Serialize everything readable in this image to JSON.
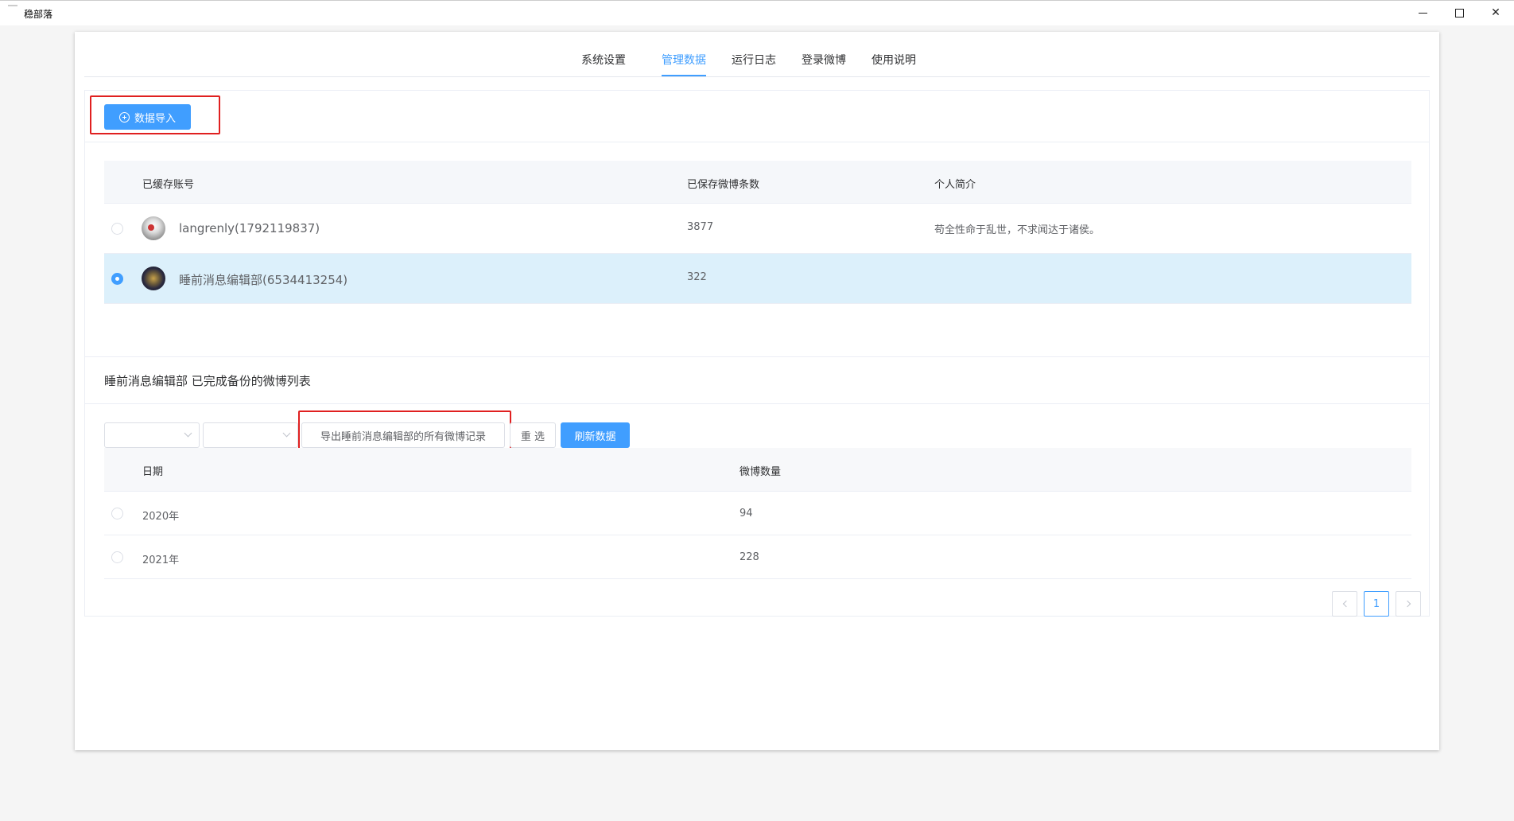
{
  "window": {
    "title": "稳部落"
  },
  "tabs": [
    {
      "label": "系统设置",
      "active": false
    },
    {
      "label": "管理数据",
      "active": true
    },
    {
      "label": "运行日志",
      "active": false
    },
    {
      "label": "登录微博",
      "active": false
    },
    {
      "label": "使用说明",
      "active": false
    }
  ],
  "toolbar": {
    "import_label": "数据导入"
  },
  "accounts": {
    "headers": [
      "已缓存账号",
      "已保存微博条数",
      "个人简介"
    ],
    "rows": [
      {
        "name": "langrenly(1792119837)",
        "count": "3877",
        "bio": "苟全性命于乱世，不求闻达于诸侯。",
        "selected": false
      },
      {
        "name": "睡前消息编辑部(6534413254)",
        "count": "322",
        "bio": "",
        "selected": true
      }
    ]
  },
  "backup": {
    "title": "睡前消息编辑部 已完成备份的微博列表"
  },
  "filters": {
    "export_label": "导出睡前消息编辑部的所有微博记录",
    "reset_label": "重 选",
    "refresh_label": "刷新数据"
  },
  "years": {
    "headers": [
      "日期",
      "微博数量"
    ],
    "rows": [
      {
        "year": "2020年",
        "count": "94"
      },
      {
        "year": "2021年",
        "count": "228"
      }
    ]
  },
  "pagination": {
    "current": "1"
  },
  "colors": {
    "accent": "#409eff",
    "highlight": "#e02020",
    "selected_row": "#dcf0fb"
  }
}
